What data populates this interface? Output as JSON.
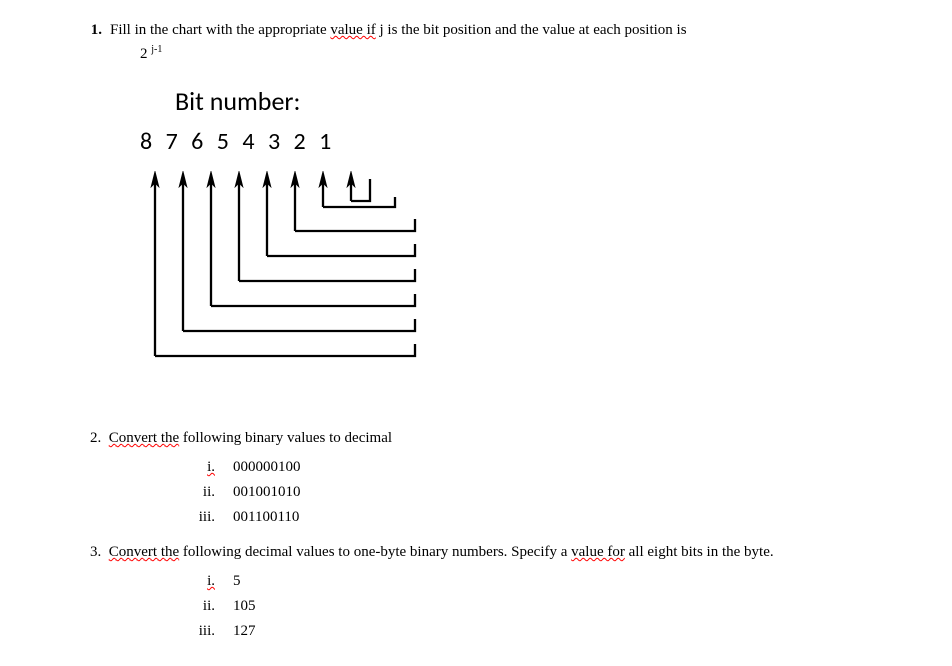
{
  "q1": {
    "number": "1.",
    "text_before_spell": "Fill in the chart with the appropriate ",
    "spell_1": "value  if",
    "text_mid": " j is the bit position and the value at each position is",
    "formula_base": "2 ",
    "formula_exp": "j-1",
    "bit_heading": "Bit number:",
    "bit_numbers": "8  7  6  5  4  3  2  1"
  },
  "q2": {
    "number": "2.",
    "spell": "Convert  the",
    "rest": " following binary values to decimal",
    "items": [
      {
        "label": "i.",
        "value": "000000100"
      },
      {
        "label": "ii.",
        "value": "001001010"
      },
      {
        "label": "iii.",
        "value": "001100110"
      }
    ]
  },
  "q3": {
    "number": "3.",
    "spell1": "Convert  the",
    "mid": " following decimal values to one-byte binary numbers.   Specify a ",
    "spell2": "value  for",
    "rest": " all eight bits in the byte.",
    "items": [
      {
        "label": "i.",
        "value": "5"
      },
      {
        "label": "ii.",
        "value": "105"
      },
      {
        "label": "iii.",
        "value": "127"
      }
    ]
  }
}
